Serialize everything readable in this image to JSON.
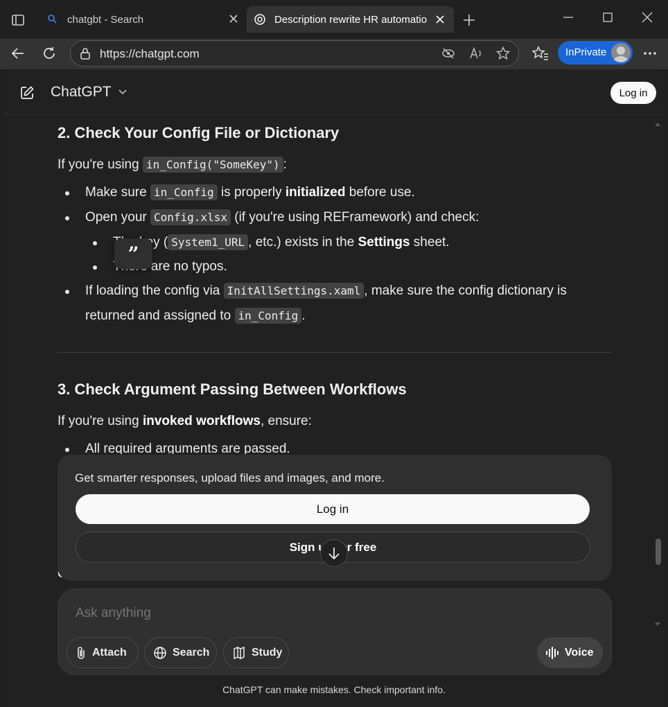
{
  "browser": {
    "tabs": [
      {
        "title": "chatgbt - Search",
        "active": false
      },
      {
        "title": "Description rewrite HR automatio",
        "active": true
      }
    ],
    "url": "https://chatgpt.com",
    "inprivate_label": "InPrivate"
  },
  "header": {
    "brand": "ChatGPT",
    "login_label": "Log in"
  },
  "content": {
    "section2": {
      "heading": "2. Check Your Config File or Dictionary",
      "intro_prefix": "If you're using ",
      "intro_code": "in_Config(\"SomeKey\")",
      "intro_suffix": ":",
      "b1_a": "Make sure ",
      "b1_code": "in_Config",
      "b1_b": " is properly ",
      "b1_bold": "initialized",
      "b1_c": " before use.",
      "b2_a": "Open your ",
      "b2_code": "Config.xlsx",
      "b2_b": " (if you're using REFramework) and check:",
      "sub1_a": "The key (",
      "sub1_code": "System1_URL",
      "sub1_b": ", etc.) exists in the ",
      "sub1_bold": "Settings",
      "sub1_c": " sheet.",
      "sub2": "There are no typos.",
      "b3_a": "If loading the config via ",
      "b3_code": "InitAllSettings.xaml",
      "b3_b": ", make sure the config dictionary is",
      "b3_line2_a": "returned and assigned to ",
      "b3_line2_code": "in_Config",
      "b3_line2_b": "."
    },
    "section3": {
      "heading": "3. Check Argument Passing Between Workflows",
      "intro_a": "If you're using ",
      "intro_bold": "invoked workflows",
      "intro_b": ", ensure:",
      "b1": "All required arguments are passed."
    },
    "obscured_text": "Ch"
  },
  "login_card": {
    "text": "Get smarter responses, upload files and images, and more.",
    "login_label": "Log in",
    "signup_label": "Sign up for free"
  },
  "composer": {
    "placeholder": "Ask anything",
    "attach_label": "Attach",
    "search_label": "Search",
    "study_label": "Study",
    "voice_label": "Voice"
  },
  "disclaimer": "ChatGPT can make mistakes. Check important info."
}
